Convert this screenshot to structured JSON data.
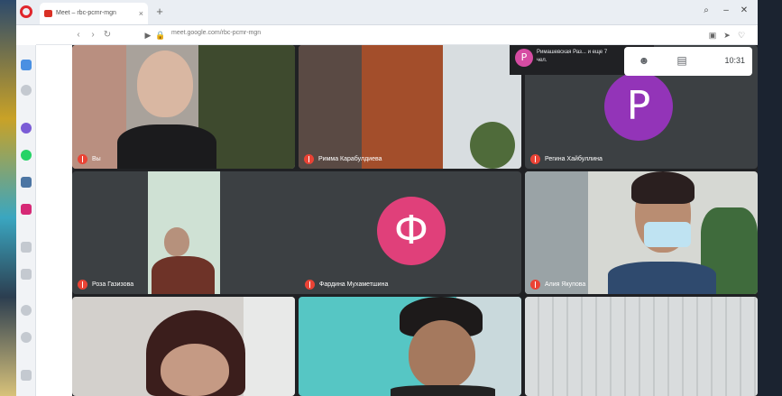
{
  "browser": {
    "tab_title": "Meet – rbc-pcmr-mgn",
    "tab_close": "×",
    "new_tab": "+",
    "url": "meet.google.com/rbc-pcmr-mgn",
    "window_controls": {
      "search": "⌕",
      "minimize": "–",
      "maximize": "▢",
      "close": "✕"
    }
  },
  "meet": {
    "chip": {
      "initial": "Р",
      "text": "Римашевская Раз... и еще 7 чел."
    },
    "clock": "10:31",
    "tiles": [
      {
        "name": "Вы"
      },
      {
        "name": "Римма Карабулдиева"
      },
      {
        "name": "Регина Хайбуллина",
        "initial": "P",
        "color": "#9334b8"
      },
      {
        "name": "Роза Газизова"
      },
      {
        "name": "Фардина Мухаметшина",
        "initial": "Ф",
        "color": "#e0407a"
      },
      {
        "name": "Алия Якупова"
      }
    ]
  },
  "icons": {
    "back": "‹",
    "forward": "›",
    "reload": "↻",
    "people": "👥",
    "chat": "▤"
  }
}
